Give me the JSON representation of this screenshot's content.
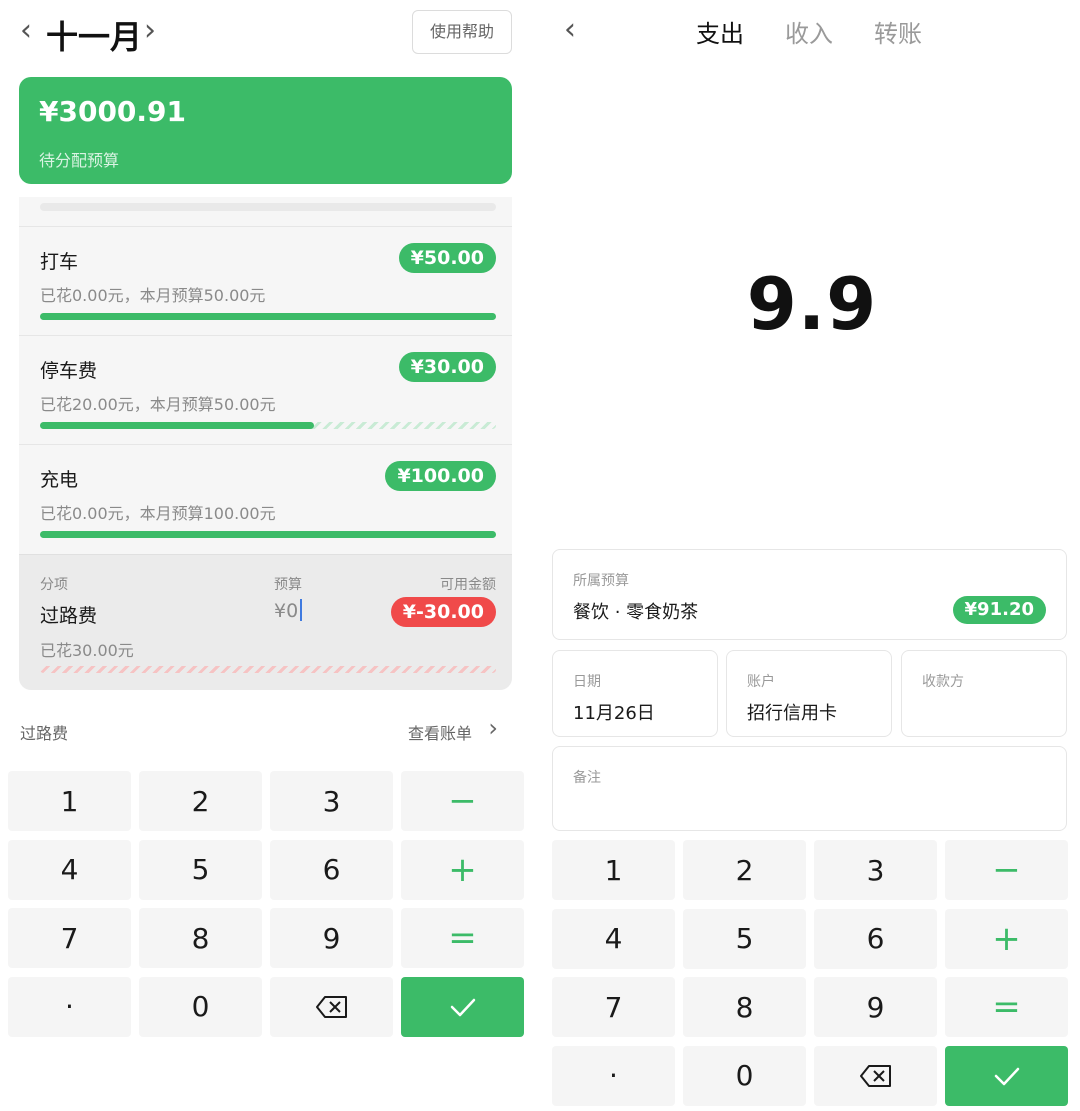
{
  "left": {
    "month_title": "十一月",
    "help_label": "使用帮助",
    "unallocated": {
      "amount": "¥3000.91",
      "label": "待分配预算"
    },
    "categories": [
      {
        "name": "打车",
        "available": "¥50.00",
        "summary": "已花0.00元，本月预算50.00元",
        "remaining_fraction": 1.0
      },
      {
        "name": "停车费",
        "available": "¥30.00",
        "summary": "已花20.00元，本月预算50.00元",
        "remaining_fraction": 0.6
      },
      {
        "name": "充电",
        "available": "¥100.00",
        "summary": "已花0.00元，本月预算100.00元",
        "remaining_fraction": 1.0
      }
    ],
    "editing": {
      "col_item": "分项",
      "col_budget": "预算",
      "col_available": "可用金额",
      "name": "过路费",
      "budget_input": "¥0",
      "available": "¥-30.00",
      "summary": "已花30.00元"
    },
    "footer": {
      "category": "过路费",
      "view_bills": "查看账单"
    }
  },
  "right": {
    "tabs": [
      "支出",
      "收入",
      "转账"
    ],
    "active_tab": 0,
    "amount": "9.9",
    "budget_field": {
      "label": "所属预算",
      "value": "餐饮 · 零食奶茶",
      "available": "¥91.20"
    },
    "date_field": {
      "label": "日期",
      "value": "11月26日"
    },
    "account_field": {
      "label": "账户",
      "value": "招行信用卡"
    },
    "payee_field": {
      "label": "收款方",
      "value": ""
    },
    "note_field": {
      "label": "备注",
      "value": ""
    }
  },
  "keypad": {
    "keys": [
      "1",
      "2",
      "3",
      "−",
      "4",
      "5",
      "6",
      "+",
      "7",
      "8",
      "9",
      "=",
      "·",
      "0",
      "backspace-icon",
      "check-icon"
    ]
  },
  "colors": {
    "accent": "#3cbb68",
    "negative": "#f04a4a"
  }
}
